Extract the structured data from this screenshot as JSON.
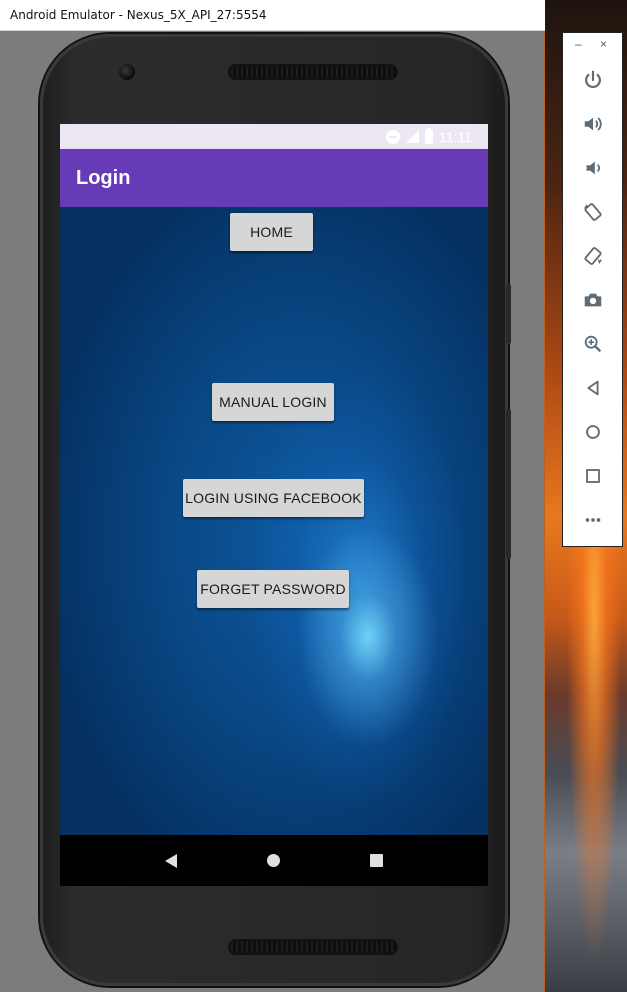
{
  "window": {
    "title": "Android Emulator - Nexus_5X_API_27:5554"
  },
  "status_bar": {
    "time": "11:11",
    "icons": [
      "do-not-disturb-icon",
      "signal-icon",
      "battery-icon"
    ]
  },
  "app_bar": {
    "title": "Login",
    "color": "#673ab7"
  },
  "buttons": {
    "home": "HOME",
    "manual_login": "MANUAL LOGIN",
    "facebook_login": "LOGIN USING FACEBOOK",
    "forget_password": "FORGET PASSWORD"
  },
  "nav_bar": {
    "items": [
      "back-icon",
      "home-icon",
      "recents-icon"
    ]
  },
  "toolbar": {
    "minimize": "–",
    "close": "×",
    "items": [
      "power-icon",
      "volume-up-icon",
      "volume-down-icon",
      "rotate-left-icon",
      "rotate-right-icon",
      "camera-icon",
      "zoom-icon",
      "back-icon",
      "home-icon",
      "overview-icon",
      "more-icon"
    ]
  },
  "colors": {
    "status_bar_bg": "#ede7f4",
    "button_bg": "#d6d6d6",
    "content_bg": "#0a4a88"
  }
}
